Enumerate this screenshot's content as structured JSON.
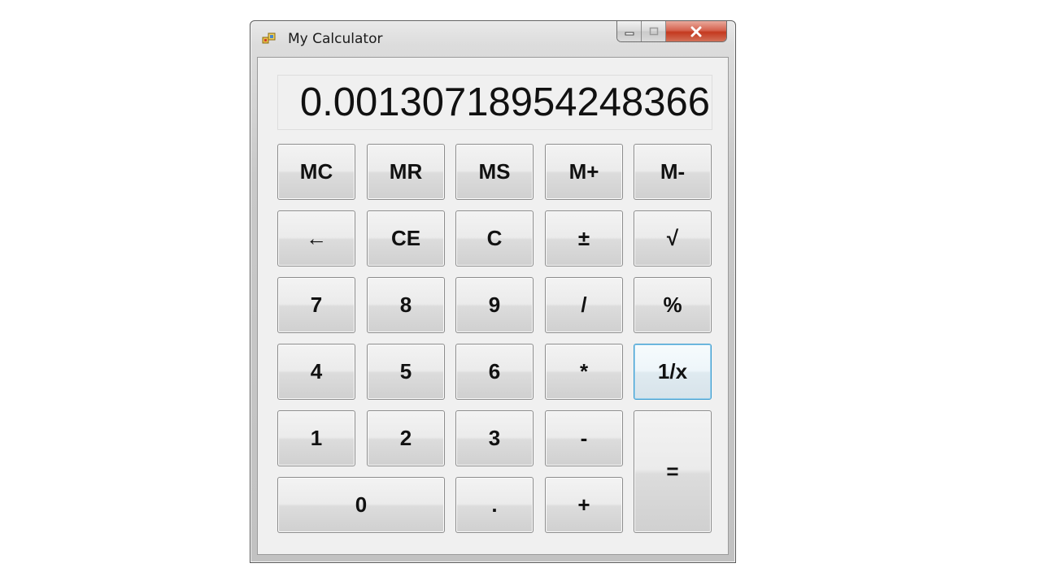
{
  "window": {
    "title": "My Calculator",
    "icon": "app-window-icon",
    "caption_buttons": [
      "minimize",
      "maximize",
      "close"
    ]
  },
  "display": {
    "value": "0.00130718954248366"
  },
  "buttons": {
    "mc": "MC",
    "mr": "MR",
    "ms": "MS",
    "m_plus": "M+",
    "m_minus": "M-",
    "backspace": "←",
    "ce": "CE",
    "c": "C",
    "plus_minus": "±",
    "sqrt": "√",
    "d7": "7",
    "d8": "8",
    "d9": "9",
    "divide": "/",
    "percent": "%",
    "d4": "4",
    "d5": "5",
    "d6": "6",
    "multiply": "*",
    "reciprocal": "1/x",
    "d1": "1",
    "d2": "2",
    "d3": "3",
    "subtract": "-",
    "equals": "=",
    "d0": "0",
    "decimal": ".",
    "add": "+"
  },
  "focused_button": "reciprocal"
}
